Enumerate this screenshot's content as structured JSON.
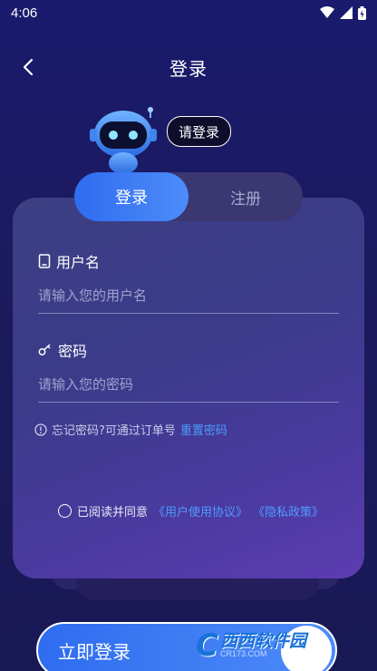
{
  "status": {
    "time": "4:06"
  },
  "header": {
    "title": "登录"
  },
  "robot": {
    "bubble": "请登录"
  },
  "tabs": {
    "login": "登录",
    "register": "注册"
  },
  "username": {
    "label": "用户名",
    "placeholder": "请输入您的用户名",
    "icon": "phone-icon"
  },
  "password": {
    "label": "密码",
    "placeholder": "请输入您的密码",
    "icon": "key-icon"
  },
  "forgot": {
    "text": "忘记密码?可通过订单号",
    "link": "重置密码"
  },
  "agreement": {
    "prefix": "已阅读并同意",
    "terms": "《用户使用协议》",
    "privacy": "《隐私政策》"
  },
  "login_button": {
    "label": "立即登录"
  },
  "watermark": {
    "logo": "C",
    "name": "西西软件园",
    "url": "CR173.COM"
  },
  "colors": {
    "accent": "#3b7cf4",
    "link": "#4c9bff",
    "background": "#1a1a6e"
  }
}
